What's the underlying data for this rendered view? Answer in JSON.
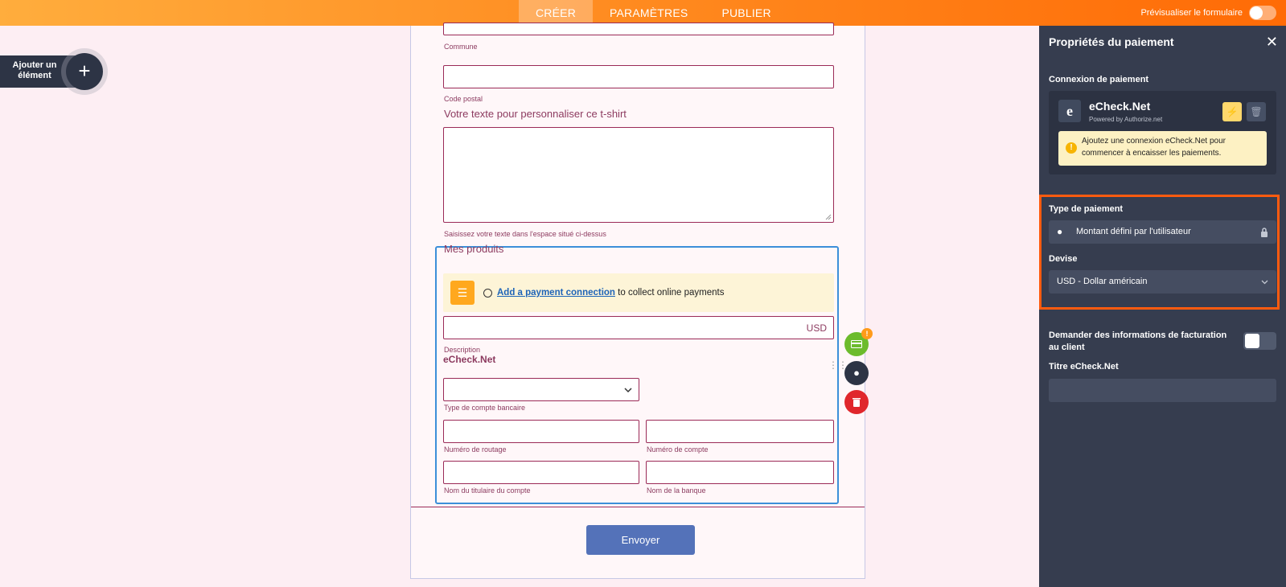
{
  "topbar": {
    "tabs": [
      {
        "label": "CRÉER",
        "active": true
      },
      {
        "label": "PARAMÈTRES",
        "active": false
      },
      {
        "label": "PUBLIER",
        "active": false
      }
    ],
    "preview_label": "Prévisualiser le formulaire"
  },
  "add_element": {
    "label": "Ajouter un élément",
    "icon": "plus-icon"
  },
  "form": {
    "commune_label": "Commune",
    "postal_label": "Code postal",
    "tshirt_question": "Votre texte pour personnaliser ce t-shirt",
    "tshirt_help": "Saisissez votre texte dans l'espace situé ci-dessus",
    "products_title": "Mes produits",
    "notice_link": "Add a payment connection",
    "notice_text": " to collect online payments",
    "amount_currency": "USD",
    "description_label": "Description",
    "echeck_title": "eCheck.Net",
    "account_type_label": "Type de compte bancaire",
    "routing_label": "Numéro de routage",
    "account_number_label": "Numéro de compte",
    "holder_label": "Nom du titulaire du compte",
    "bank_label": "Nom de la banque",
    "submit_label": "Envoyer",
    "warning_badge": "!"
  },
  "panel": {
    "title": "Propriétés du paiement",
    "close_symbol": "✕",
    "connection_heading": "Connexion de paiement",
    "connection_logo": "e",
    "connection_name": "eCheck.Net",
    "connection_sub": "Powered by Authorize.net",
    "connection_warning": "Ajoutez une connexion eCheck.Net pour commencer à encaisser les paiements.",
    "payment_type_heading": "Type de paiement",
    "payment_type_value": "Montant défini par l'utilisateur",
    "currency_heading": "Devise",
    "currency_value": "USD - Dollar américain",
    "billing_label": "Demander des informations de facturation au client",
    "titre_label": "Titre eCheck.Net"
  },
  "colors": {
    "accent_orange": "#ff8a1f",
    "panel_bg": "#363d4f",
    "field_border": "#9b2a57",
    "selection_blue": "#3c8fd9"
  }
}
